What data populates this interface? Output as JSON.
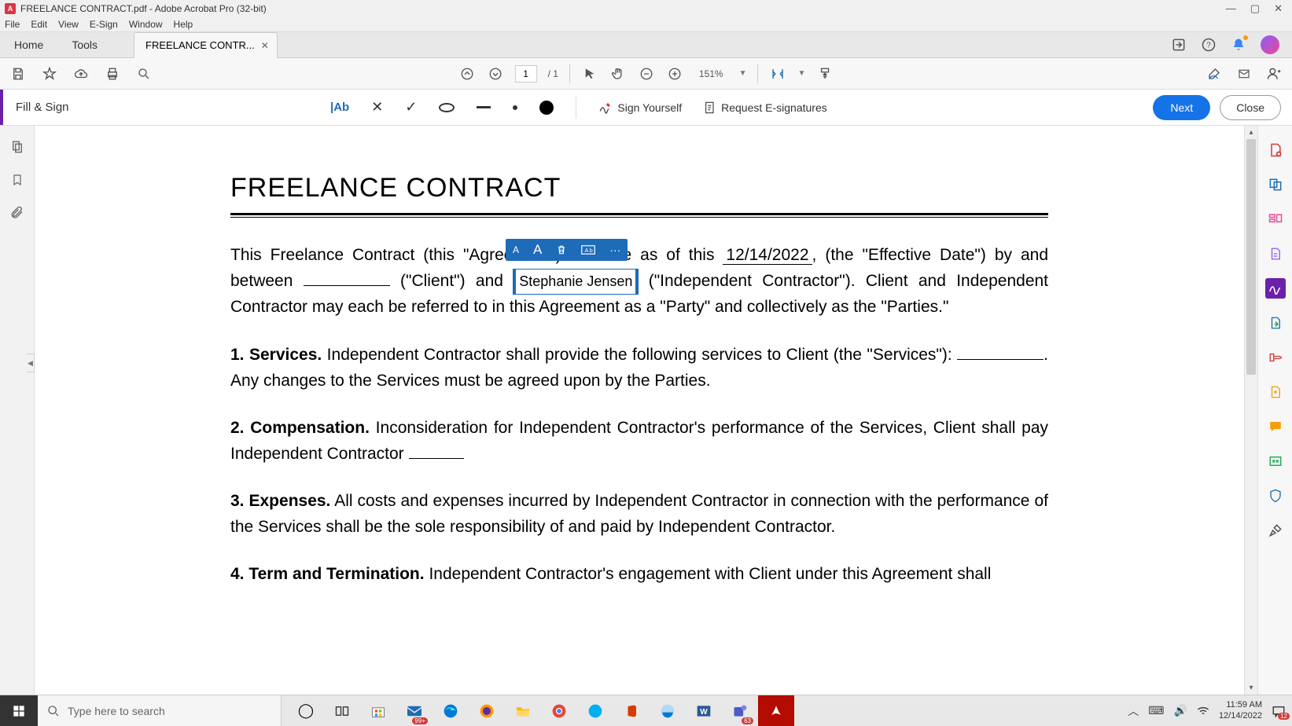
{
  "titlebar": {
    "title": "FREELANCE CONTRACT.pdf - Adobe Acrobat Pro (32-bit)"
  },
  "menubar": {
    "items": [
      "File",
      "Edit",
      "View",
      "E-Sign",
      "Window",
      "Help"
    ]
  },
  "apptabs": {
    "home": "Home",
    "tools": "Tools",
    "doc": "FREELANCE CONTR..."
  },
  "toolbar": {
    "page_current": "1",
    "page_total": "/ 1",
    "zoom": "151%"
  },
  "fillsign": {
    "label": "Fill & Sign",
    "ab": "|Ab",
    "sign_yourself": "Sign Yourself",
    "request": "Request E-signatures",
    "next": "Next",
    "close": "Close"
  },
  "document": {
    "title": "FREELANCE CONTRACT",
    "para1_a": "This Freelance Contract (this \"Agreement\") is made as of this ",
    "date_filled": "12/14/2022",
    "para1_b": ", (the \"Effective Date\") by and between ",
    "para1_c": " (\"Client\") and ",
    "name_filled": "Stephanie Jensen",
    "para1_d": " (\"Independent Contractor\"). Client and Independent Contractor may each be referred to in this Agreement as a \"Party\" and collectively as the \"Parties.\"",
    "para2_a": "1.   Services.",
    "para2_b": " Independent Contractor shall provide the following services to Client (the \"Services\"): ",
    "para2_c": ". Any changes to the Services must be agreed upon by the Parties.",
    "para3_a": "2. Compensation.",
    "para3_b": " Inconsideration for Independent Contractor's performance of the Services, Client shall pay Independent Contractor ",
    "para4_a": "3. Expenses.",
    "para4_b": " All costs and expenses incurred by Independent Contractor in connection with the performance of the Services shall be the sole responsibility of and paid by Independent Contractor.",
    "para5_a": "4. Term and Termination.",
    "para5_b": " Independent Contractor's engagement with Client under this Agreement shall"
  },
  "float_toolbar": {
    "letter_sm": "A",
    "letter_lg": "A",
    "more": "···"
  },
  "taskbar": {
    "search_placeholder": "Type here to search",
    "mail_badge": "99+",
    "teams_badge": "63",
    "time": "11:59 AM",
    "date": "12/14/2022",
    "notif_badge": "12"
  }
}
